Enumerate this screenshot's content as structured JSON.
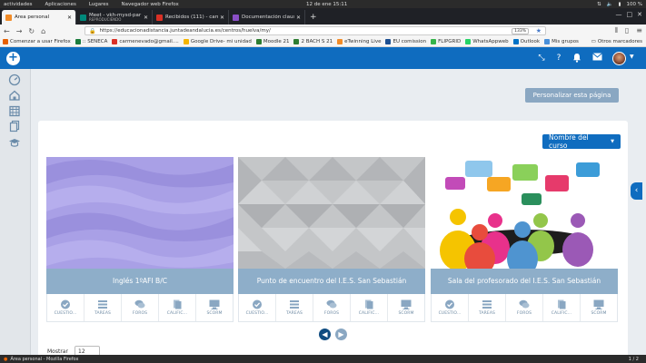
{
  "os": {
    "activities": "actividades",
    "menu_apps": "Aplicaciones",
    "menu_places": "Lugares",
    "menu_browser": "Navegador web Firefox",
    "clock": "12 de ene 15:11",
    "battery": "100 %"
  },
  "tabs": [
    {
      "title": "Área personal",
      "active": true
    },
    {
      "title": "Meet - vkh-mysd-par",
      "subtitle": "REPRODUCIENDO"
    },
    {
      "title": "Recibidos (111) - carme"
    },
    {
      "title": "Documentación claustro"
    }
  ],
  "url": {
    "value": "https://educacionadistancia.juntadeandalucia.es/centros/huelva/my/",
    "zoom": "133%"
  },
  "bookmarks": [
    "Comenzar a usar Firefox",
    ":: SENECA",
    "carmenevado@gmail....",
    "Google Drive- mi unidad",
    "Moodle 21",
    "2 BACH S 21",
    "eTwinning Live",
    "EU comission",
    "FLIPGRID",
    "WhatsAppweb",
    "Outlook",
    "Mis grupos"
  ],
  "bookmarks_other": "Otros marcadores",
  "page": {
    "customize": "Personalizar esta página",
    "sort_label": "Nombre del curso",
    "show_label": "Mostrar",
    "per_page": "12"
  },
  "courses": [
    {
      "title": "Inglés 1ºAFI B/C"
    },
    {
      "title": "Punto de encuentro del I.E.S. San Sebastián"
    },
    {
      "title": "Sala del profesorado del I.E.S. San Sebastián"
    }
  ],
  "activity_labels": [
    "CUESTIO...",
    "TAREAS",
    "FOROS",
    "CALIFIC...",
    "SCORM"
  ],
  "status": {
    "window": "Área personal - Mozilla Firefox",
    "pages": "1 / 2"
  },
  "colors": {
    "brand": "#0f6cbf",
    "course_title_bg": "#8eaec9",
    "button_muted": "#8aa7c2"
  }
}
